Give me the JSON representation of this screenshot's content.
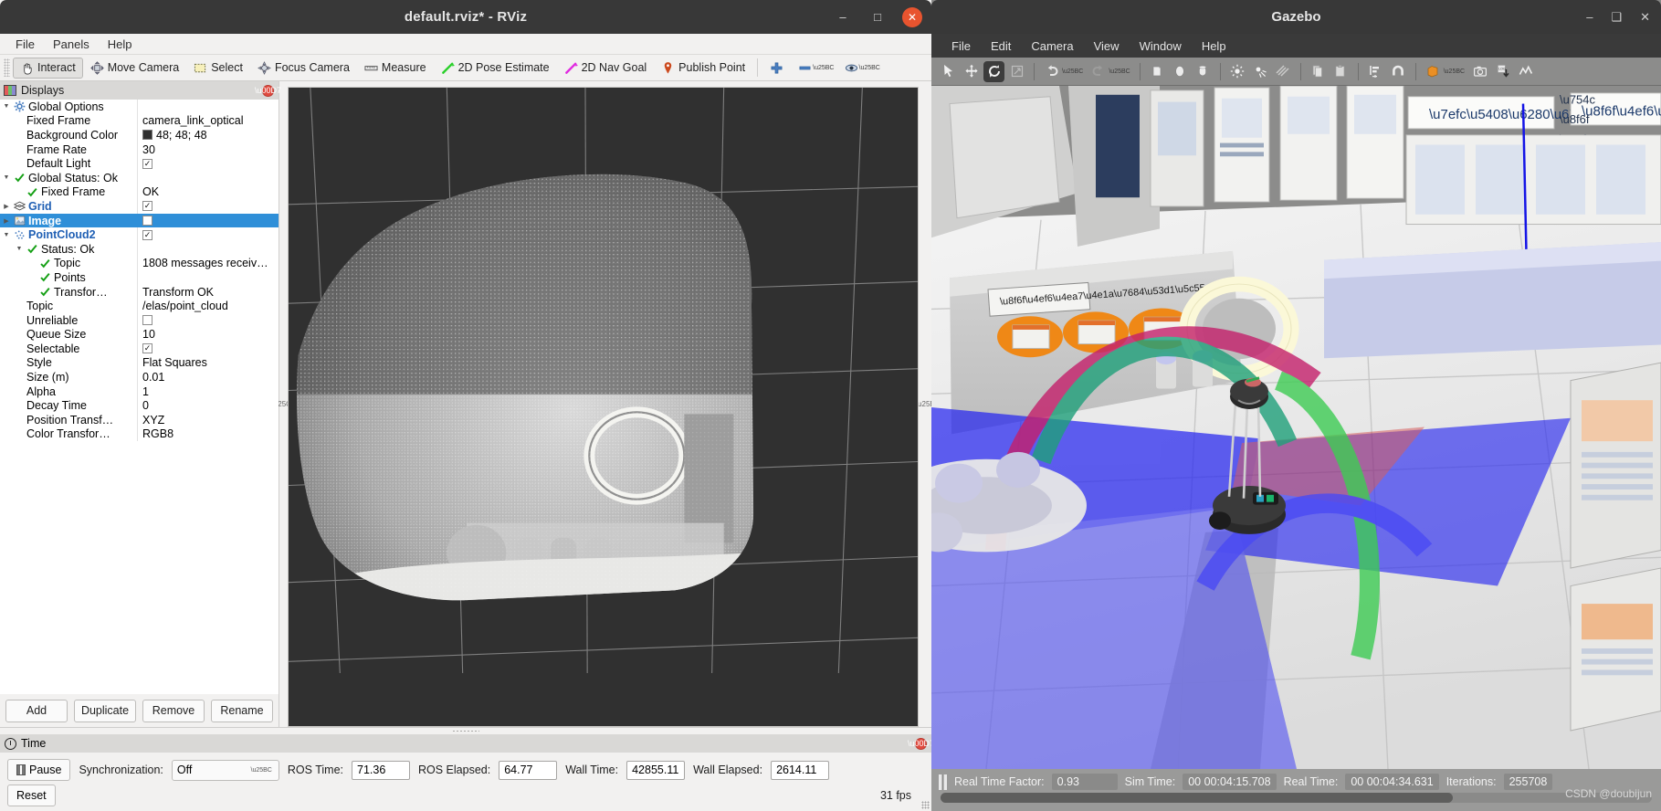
{
  "rviz": {
    "title": "default.rviz* - RViz",
    "window_buttons": {
      "minimize": "–",
      "maximize": "□",
      "close": "✕"
    },
    "menus": [
      "File",
      "Panels",
      "Help"
    ],
    "toolbar": [
      {
        "label": "Interact",
        "icon": "hand-icon",
        "active": true
      },
      {
        "label": "Move Camera",
        "icon": "move-camera-icon",
        "active": false
      },
      {
        "label": "Select",
        "icon": "select-rect-icon",
        "active": false
      },
      {
        "label": "Focus Camera",
        "icon": "focus-camera-icon",
        "active": false
      },
      {
        "label": "Measure",
        "icon": "ruler-icon",
        "active": false
      },
      {
        "label": "2D Pose Estimate",
        "icon": "pose-arrow-green-icon",
        "active": false
      },
      {
        "label": "2D Nav Goal",
        "icon": "nav-arrow-magenta-icon",
        "active": false
      },
      {
        "label": "Publish Point",
        "icon": "map-pin-icon",
        "active": false
      }
    ],
    "toolbar_right": [
      {
        "icon": "plus-icon"
      },
      {
        "icon": "minus-icon"
      },
      {
        "icon": "eye-icon"
      }
    ],
    "displays": {
      "header": "Displays",
      "rows": [
        {
          "indent": 0,
          "arrow": "open",
          "icon": "gear-icon",
          "name": "Global Options",
          "value": "",
          "value_type": "none",
          "bold": false
        },
        {
          "indent": 1,
          "arrow": "none",
          "icon": "none",
          "name": "Fixed Frame",
          "value": "camera_link_optical",
          "value_type": "text",
          "bold": false
        },
        {
          "indent": 1,
          "arrow": "none",
          "icon": "none",
          "name": "Background Color",
          "value": "48; 48; 48",
          "value_type": "color",
          "bold": false
        },
        {
          "indent": 1,
          "arrow": "none",
          "icon": "none",
          "name": "Frame Rate",
          "value": "30",
          "value_type": "text",
          "bold": false
        },
        {
          "indent": 1,
          "arrow": "none",
          "icon": "none",
          "name": "Default Light",
          "value": "checked",
          "value_type": "checkbox",
          "bold": false
        },
        {
          "indent": 0,
          "arrow": "open",
          "icon": "check-icon",
          "name": "Global Status: Ok",
          "value": "",
          "value_type": "none",
          "bold": false
        },
        {
          "indent": 1,
          "arrow": "none",
          "icon": "check-icon",
          "name": "Fixed Frame",
          "value": "OK",
          "value_type": "text",
          "bold": false
        },
        {
          "indent": 0,
          "arrow": "closed",
          "icon": "grid-icon",
          "name": "Grid",
          "value": "checked",
          "value_type": "checkbox",
          "bold": true
        },
        {
          "indent": 0,
          "arrow": "closed",
          "icon": "image-icon",
          "name": "Image",
          "value": "unchecked",
          "value_type": "checkbox",
          "bold": true,
          "selected": true
        },
        {
          "indent": 0,
          "arrow": "open",
          "icon": "pointcloud-icon",
          "name": "PointCloud2",
          "value": "checked",
          "value_type": "checkbox",
          "bold": true
        },
        {
          "indent": 1,
          "arrow": "open",
          "icon": "check-icon",
          "name": "Status: Ok",
          "value": "",
          "value_type": "none",
          "bold": false
        },
        {
          "indent": 2,
          "arrow": "none",
          "icon": "check-icon",
          "name": "Topic",
          "value": "1808 messages receiv…",
          "value_type": "text",
          "bold": false
        },
        {
          "indent": 2,
          "arrow": "none",
          "icon": "check-icon",
          "name": "Points",
          "value": "",
          "value_type": "none",
          "bold": false
        },
        {
          "indent": 2,
          "arrow": "none",
          "icon": "check-icon",
          "name": "Transfor…",
          "value": "Transform OK",
          "value_type": "text",
          "bold": false
        },
        {
          "indent": 1,
          "arrow": "none",
          "icon": "none",
          "name": "Topic",
          "value": "/elas/point_cloud",
          "value_type": "text",
          "bold": false
        },
        {
          "indent": 1,
          "arrow": "none",
          "icon": "none",
          "name": "Unreliable",
          "value": "unchecked",
          "value_type": "checkbox",
          "bold": false
        },
        {
          "indent": 1,
          "arrow": "none",
          "icon": "none",
          "name": "Queue Size",
          "value": "10",
          "value_type": "text",
          "bold": false
        },
        {
          "indent": 1,
          "arrow": "none",
          "icon": "none",
          "name": "Selectable",
          "value": "checked",
          "value_type": "checkbox",
          "bold": false
        },
        {
          "indent": 1,
          "arrow": "none",
          "icon": "none",
          "name": "Style",
          "value": "Flat Squares",
          "value_type": "text",
          "bold": false
        },
        {
          "indent": 1,
          "arrow": "none",
          "icon": "none",
          "name": "Size (m)",
          "value": "0.01",
          "value_type": "text",
          "bold": false
        },
        {
          "indent": 1,
          "arrow": "none",
          "icon": "none",
          "name": "Alpha",
          "value": "1",
          "value_type": "text",
          "bold": false
        },
        {
          "indent": 1,
          "arrow": "none",
          "icon": "none",
          "name": "Decay Time",
          "value": "0",
          "value_type": "text",
          "bold": false
        },
        {
          "indent": 1,
          "arrow": "none",
          "icon": "none",
          "name": "Position Transf…",
          "value": "XYZ",
          "value_type": "text",
          "bold": false
        },
        {
          "indent": 1,
          "arrow": "none",
          "icon": "none",
          "name": "Color Transfor…",
          "value": "RGB8",
          "value_type": "text",
          "bold": false
        }
      ],
      "buttons": [
        "Add",
        "Duplicate",
        "Remove",
        "Rename"
      ]
    },
    "time_panel": {
      "header": "Time",
      "pause_label": "Pause",
      "sync_label": "Synchronization:",
      "sync_value": "Off",
      "fields": [
        {
          "label": "ROS Time:",
          "value": "71.36"
        },
        {
          "label": "ROS Elapsed:",
          "value": "64.77"
        },
        {
          "label": "Wall Time:",
          "value": "42855.11"
        },
        {
          "label": "Wall Elapsed:",
          "value": "2614.11"
        }
      ],
      "reset_label": "Reset",
      "fps": "31 fps"
    },
    "background_color": "#303030"
  },
  "gazebo": {
    "title": "Gazebo",
    "window_buttons": {
      "minimize": "–",
      "maximize": "❑",
      "close": "✕"
    },
    "menus": [
      "File",
      "Edit",
      "Camera",
      "View",
      "Window",
      "Help"
    ],
    "toolbar": [
      {
        "icon": "arrow-select-icon",
        "active": false
      },
      {
        "icon": "translate-icon",
        "active": false
      },
      {
        "icon": "rotate-icon",
        "active": true
      },
      {
        "icon": "scale-icon",
        "active": false
      },
      {
        "icon": "undo-icon",
        "active": false
      },
      {
        "icon": "redo-icon",
        "active": false
      },
      {
        "icon": "box-icon",
        "active": false
      },
      {
        "icon": "sphere-icon",
        "active": false
      },
      {
        "icon": "cylinder-icon",
        "active": false
      },
      {
        "icon": "point-light-icon",
        "active": false
      },
      {
        "icon": "spot-light-icon",
        "active": false
      },
      {
        "icon": "directional-light-icon",
        "active": false
      },
      {
        "icon": "copy-icon",
        "active": false
      },
      {
        "icon": "paste-icon",
        "active": false
      },
      {
        "icon": "align-icon",
        "active": false
      },
      {
        "icon": "snap-magnet-icon",
        "active": false
      },
      {
        "icon": "view-angle-icon",
        "active": false
      },
      {
        "icon": "screenshot-camera-icon",
        "active": false
      },
      {
        "icon": "log-record-icon",
        "active": false
      },
      {
        "icon": "plot-icon",
        "active": false
      }
    ],
    "status": {
      "pause_icon": "pause-icon",
      "items": [
        {
          "label": "Real Time Factor:",
          "value": "0.93"
        },
        {
          "label": "Sim Time:",
          "value": "00 00:04:15.708"
        },
        {
          "label": "Real Time:",
          "value": "00 00:04:34.631"
        },
        {
          "label": "Iterations:",
          "value": "255708"
        }
      ],
      "watermark": "CSDN @doubijun"
    }
  }
}
